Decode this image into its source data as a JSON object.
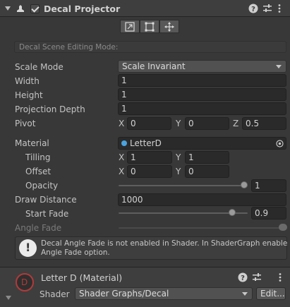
{
  "component": {
    "title": "Decal Projector",
    "enabled": true,
    "icons": [
      "help-icon",
      "settings-sliders-icon",
      "more-menu-icon"
    ]
  },
  "toolbar": {
    "buttons": [
      "edit-pivot-icon",
      "edit-bounds-icon",
      "move-icon"
    ],
    "edit_mode_label": "Decal Scene Editing Mode:"
  },
  "properties": {
    "scale_mode": {
      "label": "Scale Mode",
      "value": "Scale Invariant"
    },
    "width": {
      "label": "Width",
      "value": "1"
    },
    "height": {
      "label": "Height",
      "value": "1"
    },
    "projection_depth": {
      "label": "Projection Depth",
      "value": "1"
    },
    "pivot": {
      "label": "Pivot",
      "x_label": "X",
      "x": "0",
      "y_label": "Y",
      "y": "0",
      "z_label": "Z",
      "z": "0.5"
    },
    "material": {
      "label": "Material",
      "value": "LetterD"
    },
    "tilling": {
      "label": "Tilling",
      "x_label": "X",
      "x": "1",
      "y_label": "Y",
      "y": "1"
    },
    "offset": {
      "label": "Offset",
      "x_label": "X",
      "x": "0",
      "y_label": "Y",
      "y": "0"
    },
    "opacity": {
      "label": "Opacity",
      "value": "1",
      "fraction": 1.0
    },
    "draw_distance": {
      "label": "Draw Distance",
      "value": "1000"
    },
    "start_fade": {
      "label": "Start Fade",
      "value": "0.9",
      "fraction": 0.9
    },
    "angle_fade": {
      "label": "Angle Fade",
      "disabled": true
    }
  },
  "help_box": {
    "line1": "Decal Angle Fade is not enabled in Shader. In ShaderGraph enable",
    "line2": "Angle Fade option."
  },
  "material_section": {
    "title": "Letter D (Material)",
    "shader_label": "Shader",
    "shader_value": "Shader Graphs/Decal",
    "edit_label": "Edit..."
  },
  "colors": {
    "background": "#383838",
    "field": "#2a2a2a",
    "material_dot": "#4aa3df",
    "preview_ring": "#b23a3a"
  }
}
